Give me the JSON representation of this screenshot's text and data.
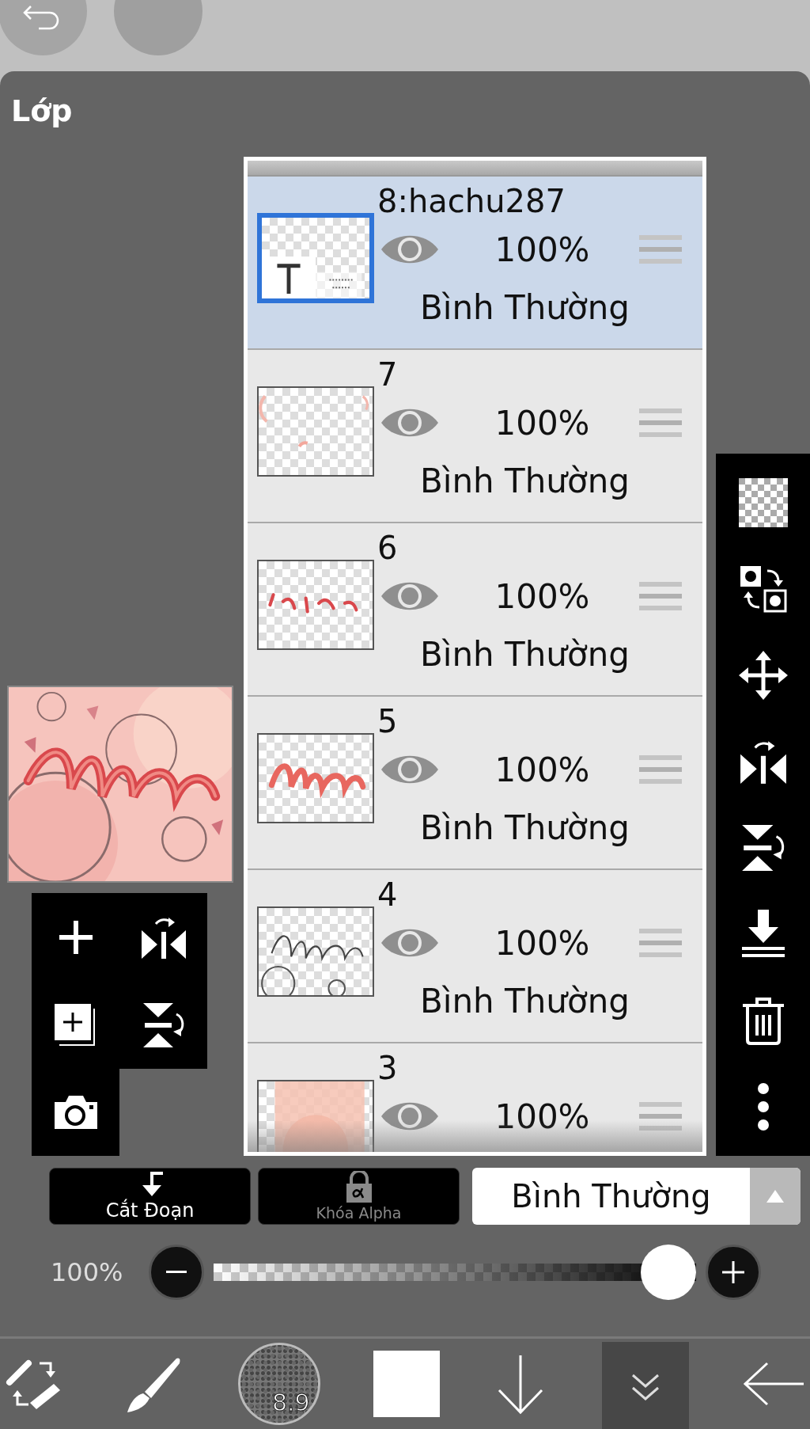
{
  "panel": {
    "title": "Lớp"
  },
  "layers": [
    {
      "name": "8:hachu287",
      "kind": "text",
      "visible": true,
      "opacity": "100%",
      "blend": "Bình Thường",
      "selected": true
    },
    {
      "name": "7",
      "kind": "arcs",
      "visible": true,
      "opacity": "100%",
      "blend": "Bình Thường",
      "selected": false
    },
    {
      "name": "6",
      "kind": "dashes",
      "visible": true,
      "opacity": "100%",
      "blend": "Bình Thường",
      "selected": false
    },
    {
      "name": "5",
      "kind": "lettering",
      "visible": true,
      "opacity": "100%",
      "blend": "Bình Thường",
      "selected": false
    },
    {
      "name": "4",
      "kind": "outline",
      "visible": true,
      "opacity": "100%",
      "blend": "Bình Thường",
      "selected": false
    },
    {
      "name": "3",
      "kind": "gradient",
      "visible": true,
      "opacity": "100%",
      "selected": false
    }
  ],
  "clipping_button": {
    "label": "Cắt Đoạn",
    "disabled": false
  },
  "alpha_lock_button": {
    "label": "Khóa Alpha",
    "disabled": true
  },
  "blend_mode": {
    "value": "Bình Thường"
  },
  "opacity_slider": {
    "reading": "100%",
    "level": 1
  },
  "brush_size": "8.9"
}
